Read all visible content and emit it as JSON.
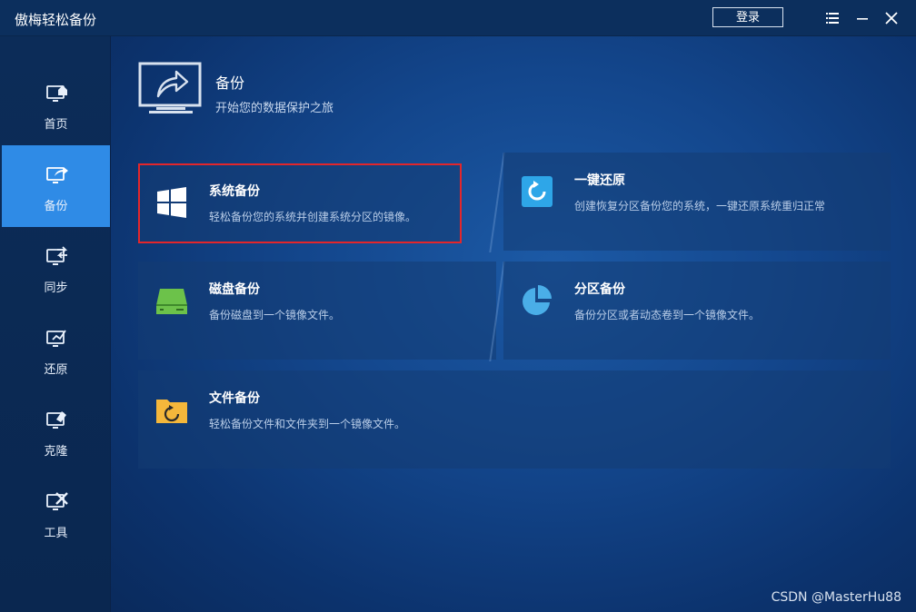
{
  "app": {
    "title": "傲梅轻松备份",
    "login_label": "登录"
  },
  "colors": {
    "accent": "#2f8be6",
    "selection_border": "#e3262b",
    "disk_green": "#6cc24a",
    "folder_yellow": "#f4b73b"
  },
  "sidebar": {
    "items": [
      {
        "label": "首页",
        "icon": "home-icon",
        "active": false
      },
      {
        "label": "备份",
        "icon": "backup-icon",
        "active": true
      },
      {
        "label": "同步",
        "icon": "sync-icon",
        "active": false
      },
      {
        "label": "还原",
        "icon": "restore-icon",
        "active": false
      },
      {
        "label": "克隆",
        "icon": "clone-icon",
        "active": false
      },
      {
        "label": "工具",
        "icon": "tools-icon",
        "active": false
      }
    ]
  },
  "header": {
    "title": "备份",
    "subtitle": "开始您的数据保护之旅"
  },
  "cards": {
    "system_backup": {
      "title": "系统备份",
      "desc": "轻松备份您的系统并创建系统分区的镜像。",
      "icon": "windows-icon"
    },
    "one_key_restore": {
      "title": "一键还原",
      "desc": "创建恢复分区备份您的系统，一键还原系统重归正常",
      "icon": "restore-circle-icon"
    },
    "disk_backup": {
      "title": "磁盘备份",
      "desc": "备份磁盘到一个镜像文件。",
      "icon": "disk-icon"
    },
    "partition_backup": {
      "title": "分区备份",
      "desc": "备份分区或者动态卷到一个镜像文件。",
      "icon": "pie-icon"
    },
    "file_backup": {
      "title": "文件备份",
      "desc": "轻松备份文件和文件夹到一个镜像文件。",
      "icon": "folder-icon"
    }
  },
  "watermark": "CSDN @MasterHu88"
}
